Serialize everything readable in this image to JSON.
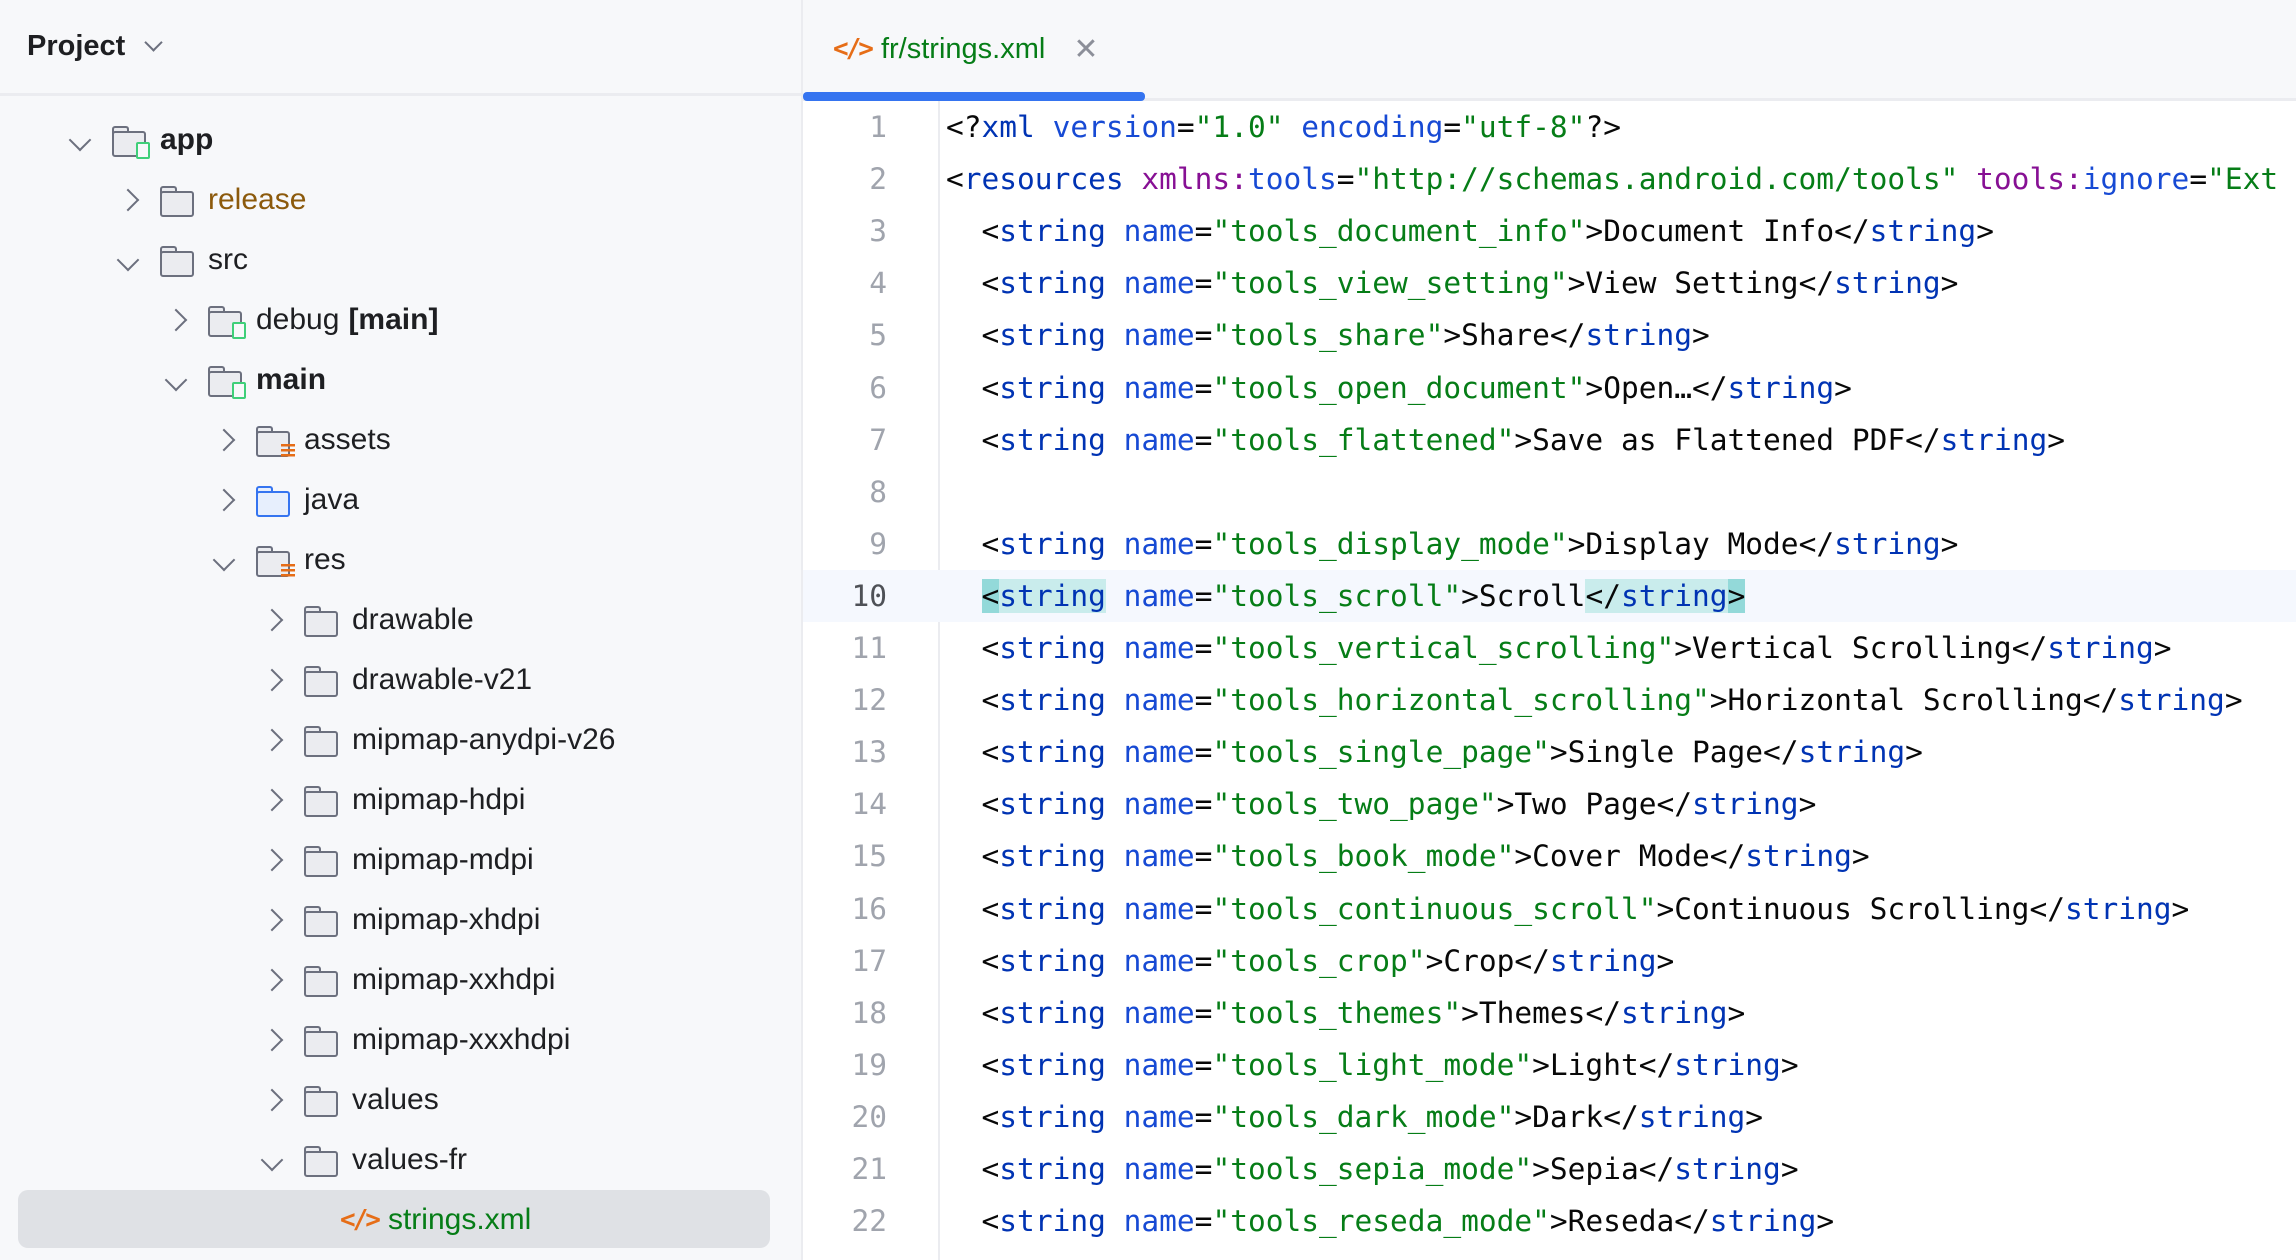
{
  "sidebar": {
    "title": "Project",
    "tree": [
      {
        "label": "app",
        "depth": 0,
        "state": "expanded",
        "icon": "module-folder-icon",
        "bold": true
      },
      {
        "label": "release",
        "depth": 1,
        "state": "collapsed",
        "icon": "folder-icon",
        "style": "release"
      },
      {
        "label": "src",
        "depth": 1,
        "state": "expanded",
        "icon": "folder-icon"
      },
      {
        "label": "debug",
        "suffix": "[main]",
        "depth": 2,
        "state": "collapsed",
        "icon": "module-folder-icon"
      },
      {
        "label": "main",
        "depth": 2,
        "state": "expanded",
        "icon": "module-folder-icon",
        "bold": true
      },
      {
        "label": "assets",
        "depth": 3,
        "state": "collapsed",
        "icon": "resource-folder-icon"
      },
      {
        "label": "java",
        "depth": 3,
        "state": "collapsed",
        "icon": "source-folder-icon"
      },
      {
        "label": "res",
        "depth": 3,
        "state": "expanded",
        "icon": "resource-folder-icon"
      },
      {
        "label": "drawable",
        "depth": 4,
        "state": "collapsed",
        "icon": "folder-icon"
      },
      {
        "label": "drawable-v21",
        "depth": 4,
        "state": "collapsed",
        "icon": "folder-icon"
      },
      {
        "label": "mipmap-anydpi-v26",
        "depth": 4,
        "state": "collapsed",
        "icon": "folder-icon"
      },
      {
        "label": "mipmap-hdpi",
        "depth": 4,
        "state": "collapsed",
        "icon": "folder-icon"
      },
      {
        "label": "mipmap-mdpi",
        "depth": 4,
        "state": "collapsed",
        "icon": "folder-icon"
      },
      {
        "label": "mipmap-xhdpi",
        "depth": 4,
        "state": "collapsed",
        "icon": "folder-icon"
      },
      {
        "label": "mipmap-xxhdpi",
        "depth": 4,
        "state": "collapsed",
        "icon": "folder-icon"
      },
      {
        "label": "mipmap-xxxhdpi",
        "depth": 4,
        "state": "collapsed",
        "icon": "folder-icon"
      },
      {
        "label": "values",
        "depth": 4,
        "state": "collapsed",
        "icon": "folder-icon"
      },
      {
        "label": "values-fr",
        "depth": 4,
        "state": "expanded",
        "icon": "folder-icon"
      },
      {
        "label": "strings.xml",
        "depth": 5,
        "state": "leaf",
        "icon": "xml-file-icon",
        "style": "green",
        "selected": true
      }
    ]
  },
  "tab": {
    "label": "fr/strings.xml",
    "icon": "xml-file-icon",
    "close": "✕"
  },
  "editor": {
    "current_line": 10,
    "lines": [
      [
        [
          "p",
          "<?"
        ],
        [
          "tag",
          "xml "
        ],
        [
          "attr",
          "version"
        ],
        [
          "p",
          "="
        ],
        [
          "str",
          "\"1.0\" "
        ],
        [
          "attr",
          "encoding"
        ],
        [
          "p",
          "="
        ],
        [
          "str",
          "\"utf-8\""
        ],
        [
          "p",
          "?>"
        ]
      ],
      [
        [
          "p",
          "<"
        ],
        [
          "tag",
          "resources "
        ],
        [
          "ns",
          "xmlns:"
        ],
        [
          "attr",
          "tools"
        ],
        [
          "p",
          "="
        ],
        [
          "str",
          "\"http://schemas.android.com/tools\" "
        ],
        [
          "ns",
          "tools:"
        ],
        [
          "attr",
          "ignore"
        ],
        [
          "p",
          "="
        ],
        [
          "str",
          "\"Ext"
        ]
      ],
      [
        [
          "p",
          "  <"
        ],
        [
          "tag",
          "string "
        ],
        [
          "attr",
          "name"
        ],
        [
          "p",
          "="
        ],
        [
          "str",
          "\"tools_document_info\""
        ],
        [
          "p",
          ">"
        ],
        [
          "txt",
          "Document Info"
        ],
        [
          "p",
          "</"
        ],
        [
          "tag",
          "string"
        ],
        [
          "p",
          ">"
        ]
      ],
      [
        [
          "p",
          "  <"
        ],
        [
          "tag",
          "string "
        ],
        [
          "attr",
          "name"
        ],
        [
          "p",
          "="
        ],
        [
          "str",
          "\"tools_view_setting\""
        ],
        [
          "p",
          ">"
        ],
        [
          "txt",
          "View Setting"
        ],
        [
          "p",
          "</"
        ],
        [
          "tag",
          "string"
        ],
        [
          "p",
          ">"
        ]
      ],
      [
        [
          "p",
          "  <"
        ],
        [
          "tag",
          "string "
        ],
        [
          "attr",
          "name"
        ],
        [
          "p",
          "="
        ],
        [
          "str",
          "\"tools_share\""
        ],
        [
          "p",
          ">"
        ],
        [
          "txt",
          "Share"
        ],
        [
          "p",
          "</"
        ],
        [
          "tag",
          "string"
        ],
        [
          "p",
          ">"
        ]
      ],
      [
        [
          "p",
          "  <"
        ],
        [
          "tag",
          "string "
        ],
        [
          "attr",
          "name"
        ],
        [
          "p",
          "="
        ],
        [
          "str",
          "\"tools_open_document\""
        ],
        [
          "p",
          ">"
        ],
        [
          "txt",
          "Open…"
        ],
        [
          "p",
          "</"
        ],
        [
          "tag",
          "string"
        ],
        [
          "p",
          ">"
        ]
      ],
      [
        [
          "p",
          "  <"
        ],
        [
          "tag",
          "string "
        ],
        [
          "attr",
          "name"
        ],
        [
          "p",
          "="
        ],
        [
          "str",
          "\"tools_flattened\""
        ],
        [
          "p",
          ">"
        ],
        [
          "txt",
          "Save as Flattened PDF"
        ],
        [
          "p",
          "</"
        ],
        [
          "tag",
          "string"
        ],
        [
          "p",
          ">"
        ]
      ],
      [],
      [
        [
          "p",
          "  <"
        ],
        [
          "tag",
          "string "
        ],
        [
          "attr",
          "name"
        ],
        [
          "p",
          "="
        ],
        [
          "str",
          "\"tools_display_mode\""
        ],
        [
          "p",
          ">"
        ],
        [
          "txt",
          "Display Mode"
        ],
        [
          "p",
          "</"
        ],
        [
          "tag",
          "string"
        ],
        [
          "p",
          ">"
        ]
      ],
      [
        [
          "p",
          "  "
        ],
        [
          "p",
          "<",
          "hlb"
        ],
        [
          "tag",
          "string",
          "hl"
        ],
        [
          "p",
          " "
        ],
        [
          "attr",
          "name"
        ],
        [
          "p",
          "="
        ],
        [
          "str",
          "\"tools_scroll\""
        ],
        [
          "p",
          ">"
        ],
        [
          "txt",
          "Scroll"
        ],
        [
          "p",
          "</",
          "hl"
        ],
        [
          "tag",
          "string",
          "hl"
        ],
        [
          "p",
          ">",
          "hlb"
        ]
      ],
      [
        [
          "p",
          "  <"
        ],
        [
          "tag",
          "string "
        ],
        [
          "attr",
          "name"
        ],
        [
          "p",
          "="
        ],
        [
          "str",
          "\"tools_vertical_scrolling\""
        ],
        [
          "p",
          ">"
        ],
        [
          "txt",
          "Vertical Scrolling"
        ],
        [
          "p",
          "</"
        ],
        [
          "tag",
          "string"
        ],
        [
          "p",
          ">"
        ]
      ],
      [
        [
          "p",
          "  <"
        ],
        [
          "tag",
          "string "
        ],
        [
          "attr",
          "name"
        ],
        [
          "p",
          "="
        ],
        [
          "str",
          "\"tools_horizontal_scrolling\""
        ],
        [
          "p",
          ">"
        ],
        [
          "txt",
          "Horizontal Scrolling"
        ],
        [
          "p",
          "</"
        ],
        [
          "tag",
          "string"
        ],
        [
          "p",
          ">"
        ]
      ],
      [
        [
          "p",
          "  <"
        ],
        [
          "tag",
          "string "
        ],
        [
          "attr",
          "name"
        ],
        [
          "p",
          "="
        ],
        [
          "str",
          "\"tools_single_page\""
        ],
        [
          "p",
          ">"
        ],
        [
          "txt",
          "Single Page"
        ],
        [
          "p",
          "</"
        ],
        [
          "tag",
          "string"
        ],
        [
          "p",
          ">"
        ]
      ],
      [
        [
          "p",
          "  <"
        ],
        [
          "tag",
          "string "
        ],
        [
          "attr",
          "name"
        ],
        [
          "p",
          "="
        ],
        [
          "str",
          "\"tools_two_page\""
        ],
        [
          "p",
          ">"
        ],
        [
          "txt",
          "Two Page"
        ],
        [
          "p",
          "</"
        ],
        [
          "tag",
          "string"
        ],
        [
          "p",
          ">"
        ]
      ],
      [
        [
          "p",
          "  <"
        ],
        [
          "tag",
          "string "
        ],
        [
          "attr",
          "name"
        ],
        [
          "p",
          "="
        ],
        [
          "str",
          "\"tools_book_mode\""
        ],
        [
          "p",
          ">"
        ],
        [
          "txt",
          "Cover Mode"
        ],
        [
          "p",
          "</"
        ],
        [
          "tag",
          "string"
        ],
        [
          "p",
          ">"
        ]
      ],
      [
        [
          "p",
          "  <"
        ],
        [
          "tag",
          "string "
        ],
        [
          "attr",
          "name"
        ],
        [
          "p",
          "="
        ],
        [
          "str",
          "\"tools_continuous_scroll\""
        ],
        [
          "p",
          ">"
        ],
        [
          "txt",
          "Continuous Scrolling"
        ],
        [
          "p",
          "</"
        ],
        [
          "tag",
          "string"
        ],
        [
          "p",
          ">"
        ]
      ],
      [
        [
          "p",
          "  <"
        ],
        [
          "tag",
          "string "
        ],
        [
          "attr",
          "name"
        ],
        [
          "p",
          "="
        ],
        [
          "str",
          "\"tools_crop\""
        ],
        [
          "p",
          ">"
        ],
        [
          "txt",
          "Crop"
        ],
        [
          "p",
          "</"
        ],
        [
          "tag",
          "string"
        ],
        [
          "p",
          ">"
        ]
      ],
      [
        [
          "p",
          "  <"
        ],
        [
          "tag",
          "string "
        ],
        [
          "attr",
          "name"
        ],
        [
          "p",
          "="
        ],
        [
          "str",
          "\"tools_themes\""
        ],
        [
          "p",
          ">"
        ],
        [
          "txt",
          "Themes"
        ],
        [
          "p",
          "</"
        ],
        [
          "tag",
          "string"
        ],
        [
          "p",
          ">"
        ]
      ],
      [
        [
          "p",
          "  <"
        ],
        [
          "tag",
          "string "
        ],
        [
          "attr",
          "name"
        ],
        [
          "p",
          "="
        ],
        [
          "str",
          "\"tools_light_mode\""
        ],
        [
          "p",
          ">"
        ],
        [
          "txt",
          "Light"
        ],
        [
          "p",
          "</"
        ],
        [
          "tag",
          "string"
        ],
        [
          "p",
          ">"
        ]
      ],
      [
        [
          "p",
          "  <"
        ],
        [
          "tag",
          "string "
        ],
        [
          "attr",
          "name"
        ],
        [
          "p",
          "="
        ],
        [
          "str",
          "\"tools_dark_mode\""
        ],
        [
          "p",
          ">"
        ],
        [
          "txt",
          "Dark"
        ],
        [
          "p",
          "</"
        ],
        [
          "tag",
          "string"
        ],
        [
          "p",
          ">"
        ]
      ],
      [
        [
          "p",
          "  <"
        ],
        [
          "tag",
          "string "
        ],
        [
          "attr",
          "name"
        ],
        [
          "p",
          "="
        ],
        [
          "str",
          "\"tools_sepia_mode\""
        ],
        [
          "p",
          ">"
        ],
        [
          "txt",
          "Sepia"
        ],
        [
          "p",
          "</"
        ],
        [
          "tag",
          "string"
        ],
        [
          "p",
          ">"
        ]
      ],
      [
        [
          "p",
          "  <"
        ],
        [
          "tag",
          "string "
        ],
        [
          "attr",
          "name"
        ],
        [
          "p",
          "="
        ],
        [
          "str",
          "\"tools_reseda_mode\""
        ],
        [
          "p",
          ">"
        ],
        [
          "txt",
          "Reseda"
        ],
        [
          "p",
          "</"
        ],
        [
          "tag",
          "string"
        ],
        [
          "p",
          ">"
        ]
      ]
    ]
  },
  "colors": {
    "accent": "#3574f0",
    "xml_string": "#067d17",
    "xml_tag": "#0033b3",
    "namespace": "#871094",
    "file_icon": "#e66d17"
  }
}
